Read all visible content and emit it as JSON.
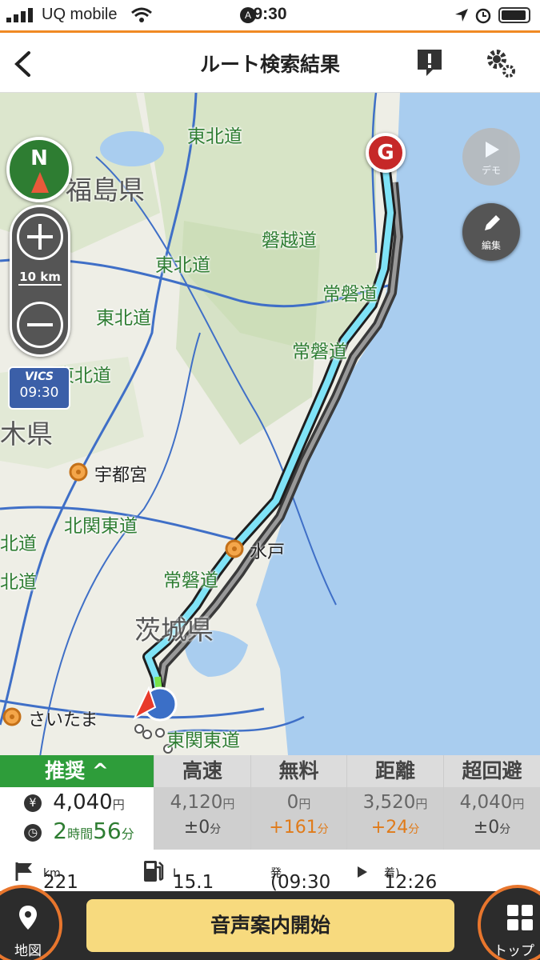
{
  "status_bar": {
    "carrier": "UQ mobile",
    "time": "9:30"
  },
  "nav": {
    "title": "ルート検索結果"
  },
  "map": {
    "compass_label": "N",
    "scale_label": "10 km",
    "vics": {
      "label": "VICS",
      "time": "09:30"
    },
    "demo_label": "デモ",
    "edit_label": "編集",
    "goal_label": "G",
    "labels": {
      "tohoku_1": "東北道",
      "tohoku_2": "東北道",
      "tohoku_3": "東北道",
      "tohoku_4": "東北道",
      "banetsu": "磐越道",
      "joban_1": "常磐道",
      "joban_2": "常磐道",
      "joban_3": "常磐道",
      "kitakanto": "北関東道",
      "higashikanto": "東関東道",
      "kita_1": "北道",
      "kita_2": "北道",
      "fukushima": "福島県",
      "tochigi": "木県",
      "ibaraki": "茨城県",
      "utsunomiya": "宇都宮",
      "mito": "水戸",
      "saitama": "さいたま"
    }
  },
  "tabs": {
    "recommended": {
      "label": "推奨 ^",
      "cost": "4,040",
      "cost_unit": "円",
      "hours": "2",
      "hours_unit": "時間",
      "minutes": "56",
      "minutes_unit": "分"
    },
    "highway": {
      "label": "高速",
      "cost": "4,120",
      "cost_unit": "円",
      "diff": "±0",
      "diff_unit": "分"
    },
    "free": {
      "label": "無料",
      "cost": "0",
      "cost_unit": "円",
      "diff": "+161",
      "diff_unit": "分"
    },
    "distance": {
      "label": "距離",
      "cost": "3,520",
      "cost_unit": "円",
      "diff": "+24",
      "diff_unit": "分"
    },
    "avoid": {
      "label": "超回避",
      "cost": "4,040",
      "cost_unit": "円",
      "diff": "±0",
      "diff_unit": "分"
    }
  },
  "summary": {
    "distance": "221",
    "distance_unit": "km",
    "fuel": "15.1",
    "fuel_unit": "L",
    "depart": "(09:30",
    "depart_suffix": "発",
    "arrive": "12:26",
    "arrive_suffix": "着)"
  },
  "bottom": {
    "map_label": "地図",
    "start_label": "音声案内開始",
    "top_label": "トップ"
  },
  "colors": {
    "accent": "#f08a24",
    "recommended": "#2e9d3a",
    "route": "#7fe3f7",
    "goal": "#c62828",
    "sea": "#a9cdef"
  }
}
